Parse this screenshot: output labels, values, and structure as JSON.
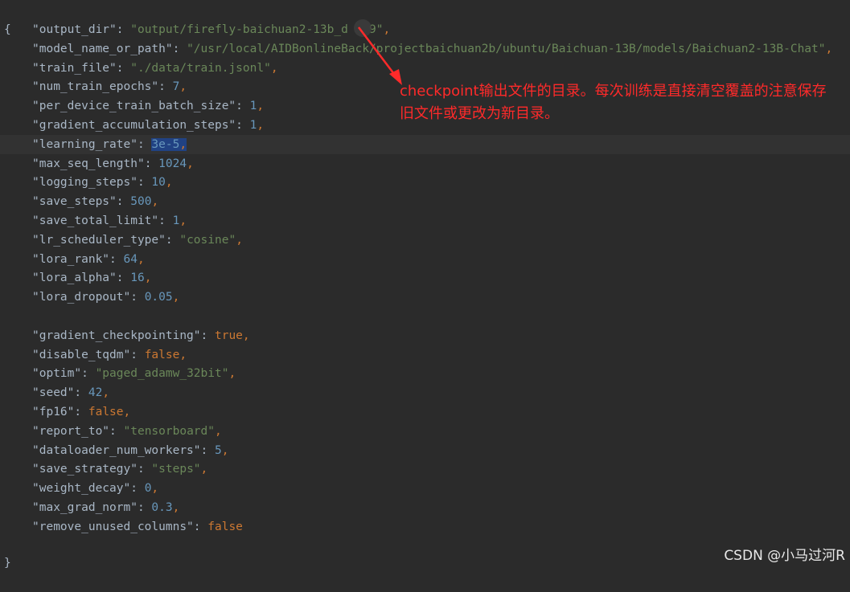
{
  "editor": {
    "open_brace": "{",
    "close_brace": "}",
    "lines": [
      {
        "key": "\"output_dir\"",
        "value": "\"output/firefly-baichuan2-13b_d   9\"",
        "type": "str",
        "comma": true
      },
      {
        "key": "\"model_name_or_path\"",
        "value": "\"/usr/local/AIDBonlineBack/projectbaichuan2b/ubuntu/Baichuan-13B/models/Baichuan2-13B-Chat\"",
        "type": "str",
        "comma": true
      },
      {
        "key": "\"train_file\"",
        "value": "\"./data/train.jsonl\"",
        "type": "str",
        "comma": true
      },
      {
        "key": "\"num_train_epochs\"",
        "value": "7",
        "type": "num",
        "comma": true
      },
      {
        "key": "\"per_device_train_batch_size\"",
        "value": "1",
        "type": "num",
        "comma": true
      },
      {
        "key": "\"gradient_accumulation_steps\"",
        "value": "1",
        "type": "num",
        "comma": true
      },
      {
        "key": "\"learning_rate\"",
        "value": "3e-5",
        "type": "num",
        "comma": true,
        "selected": true
      },
      {
        "key": "\"max_seq_length\"",
        "value": "1024",
        "type": "num",
        "comma": true
      },
      {
        "key": "\"logging_steps\"",
        "value": "10",
        "type": "num",
        "comma": true
      },
      {
        "key": "\"save_steps\"",
        "value": "500",
        "type": "num",
        "comma": true
      },
      {
        "key": "\"save_total_limit\"",
        "value": "1",
        "type": "num",
        "comma": true
      },
      {
        "key": "\"lr_scheduler_type\"",
        "value": "\"cosine\"",
        "type": "str",
        "comma": true
      },
      {
        "key": "\"lora_rank\"",
        "value": "64",
        "type": "num",
        "comma": true
      },
      {
        "key": "\"lora_alpha\"",
        "value": "16",
        "type": "num",
        "comma": true
      },
      {
        "key": "\"lora_dropout\"",
        "value": "0.05",
        "type": "num",
        "comma": true
      },
      {
        "blank": true
      },
      {
        "key": "\"gradient_checkpointing\"",
        "value": "true",
        "type": "kw",
        "comma": true
      },
      {
        "key": "\"disable_tqdm\"",
        "value": "false",
        "type": "kw",
        "comma": true
      },
      {
        "key": "\"optim\"",
        "value": "\"paged_adamw_32bit\"",
        "type": "str",
        "comma": true
      },
      {
        "key": "\"seed\"",
        "value": "42",
        "type": "num",
        "comma": true
      },
      {
        "key": "\"fp16\"",
        "value": "false",
        "type": "kw",
        "comma": true
      },
      {
        "key": "\"report_to\"",
        "value": "\"tensorboard\"",
        "type": "str",
        "comma": true
      },
      {
        "key": "\"dataloader_num_workers\"",
        "value": "5",
        "type": "num",
        "comma": true
      },
      {
        "key": "\"save_strategy\"",
        "value": "\"steps\"",
        "type": "str",
        "comma": true
      },
      {
        "key": "\"weight_decay\"",
        "value": "0",
        "type": "num",
        "comma": true
      },
      {
        "key": "\"max_grad_norm\"",
        "value": "0.3",
        "type": "num",
        "comma": true
      },
      {
        "key": "\"remove_unused_columns\"",
        "value": "false",
        "type": "kw",
        "comma": false
      }
    ]
  },
  "annotation": {
    "text": "checkpoint输出文件的目录。每次训练是直接清空覆盖的注意保存旧文件或更改为新目录。",
    "color": "#ff2a2a"
  },
  "watermark": "CSDN @小马过河R",
  "colors": {
    "background": "#2b2b2b",
    "string": "#6a8759",
    "number": "#6897bb",
    "keyword": "#cc7832",
    "selection": "#214283"
  }
}
